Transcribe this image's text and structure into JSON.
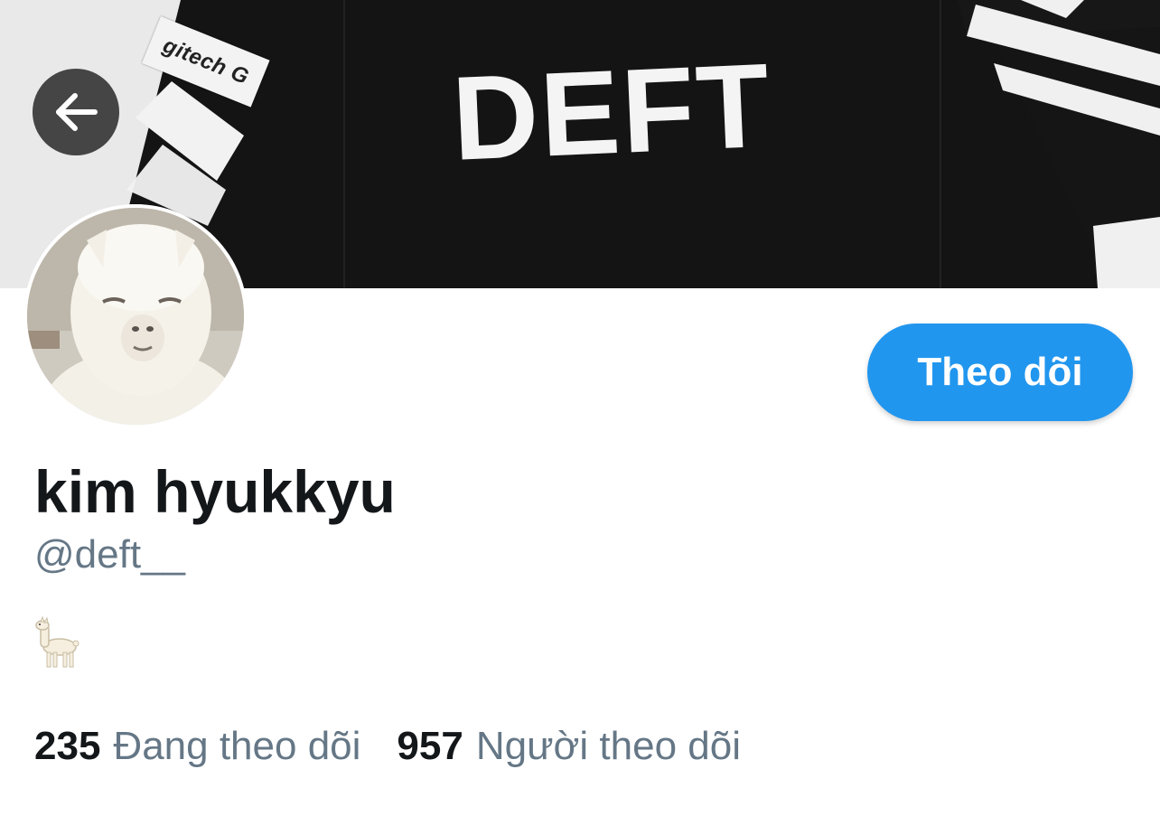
{
  "banner": {
    "jersey_text": "DEFT",
    "sponsor_text": "gitech G"
  },
  "profile": {
    "display_name": "kim hyukkyu",
    "handle": "@deft__",
    "bio_emoji_icon": "llama-icon"
  },
  "actions": {
    "follow_label": "Theo dõi",
    "back_icon": "arrow-left-icon"
  },
  "stats": {
    "following_count": "235",
    "following_label": "Đang theo dõi",
    "followers_count": "957",
    "followers_label": "Người theo dõi"
  },
  "colors": {
    "accent": "#2196ee",
    "text_primary": "#14171a",
    "text_secondary": "#657786"
  }
}
